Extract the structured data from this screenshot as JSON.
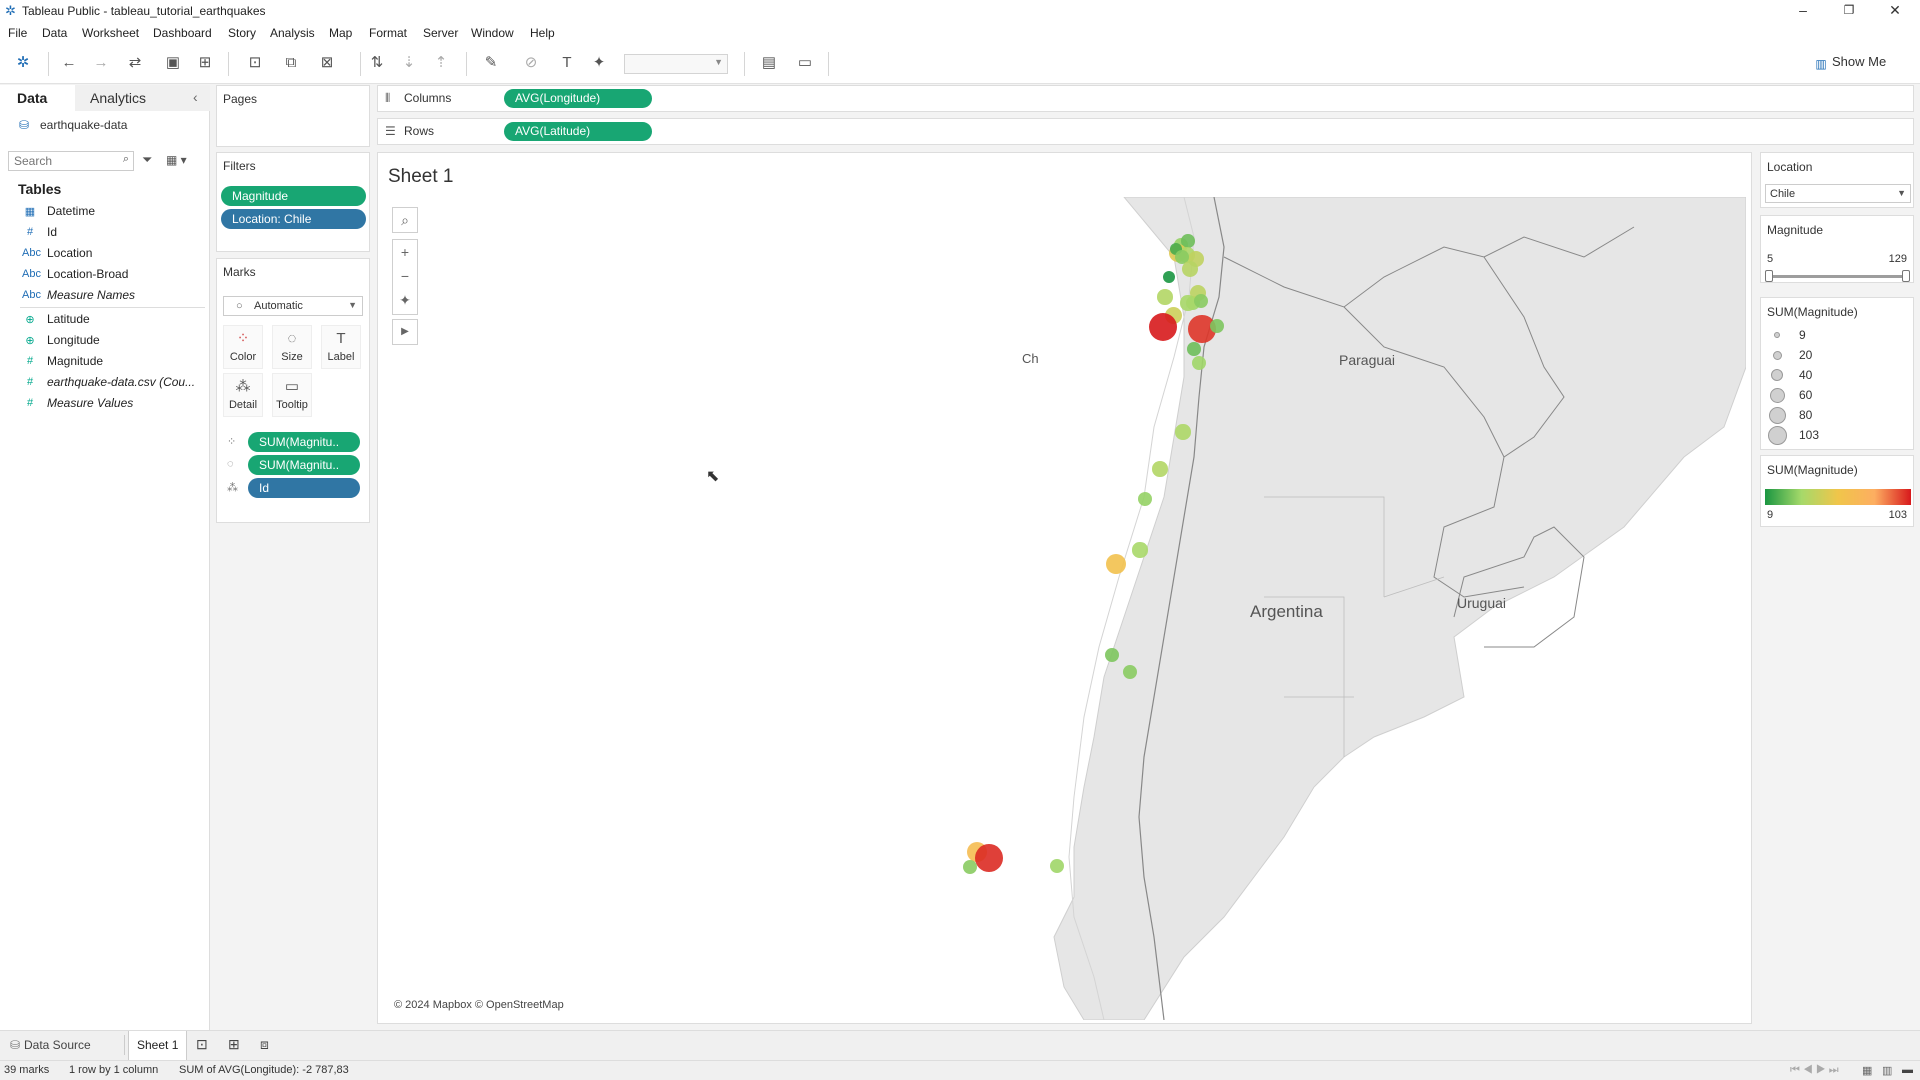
{
  "window": {
    "title": "Tableau Public - tableau_tutorial_earthquakes",
    "controls": [
      "–",
      "❐",
      "✕"
    ]
  },
  "menu": [
    "File",
    "Data",
    "Worksheet",
    "Dashboard",
    "Story",
    "Analysis",
    "Map",
    "Format",
    "Server",
    "Window",
    "Help"
  ],
  "toolbar": {
    "show_me": "Show Me"
  },
  "datapane": {
    "tabs": [
      "Data",
      "Analytics"
    ],
    "datasource": "earthquake-data",
    "search_placeholder": "Search",
    "tables_heading": "Tables",
    "fields": [
      {
        "icon": "calendar-icon",
        "glyph": "▦",
        "name": "Datetime",
        "kind": "dim"
      },
      {
        "icon": "hash-icon",
        "glyph": "#",
        "name": "Id",
        "kind": "dim"
      },
      {
        "icon": "abc-icon",
        "glyph": "Abc",
        "name": "Location",
        "kind": "dim"
      },
      {
        "icon": "abc-icon",
        "glyph": "Abc",
        "name": "Location-Broad",
        "kind": "dim"
      },
      {
        "icon": "abc-icon",
        "glyph": "Abc",
        "name": "Measure Names",
        "kind": "dim",
        "italic": true
      },
      {
        "icon": "globe-icon",
        "glyph": "⊕",
        "name": "Latitude",
        "kind": "mea"
      },
      {
        "icon": "globe-icon",
        "glyph": "⊕",
        "name": "Longitude",
        "kind": "mea"
      },
      {
        "icon": "hash-icon",
        "glyph": "#",
        "name": "Magnitude",
        "kind": "mea"
      },
      {
        "icon": "hash-icon",
        "glyph": "#",
        "name": "earthquake-data.csv (Cou...",
        "kind": "mea",
        "italic": true
      },
      {
        "icon": "hash-icon",
        "glyph": "#",
        "name": "Measure Values",
        "kind": "mea",
        "italic": true
      }
    ]
  },
  "cards": {
    "pages": "Pages",
    "filters": "Filters",
    "filter_pills": [
      "Magnitude",
      "Location: Chile"
    ],
    "marks": "Marks",
    "mark_type": "Automatic",
    "mark_buttons": [
      {
        "name": "color",
        "label": "Color",
        "glyph": "⁘"
      },
      {
        "name": "size",
        "label": "Size",
        "glyph": "◌"
      },
      {
        "name": "label",
        "label": "Label",
        "glyph": "T"
      },
      {
        "name": "detail",
        "label": "Detail",
        "glyph": "⁂"
      },
      {
        "name": "tooltip",
        "label": "Tooltip",
        "glyph": "▭"
      }
    ],
    "mark_pills": [
      {
        "icon": "color-icon",
        "glyph": "⁘",
        "text": "SUM(Magnitu..",
        "color": "green"
      },
      {
        "icon": "size-icon",
        "glyph": "◌",
        "text": "SUM(Magnitu..",
        "color": "green"
      },
      {
        "icon": "detail-icon",
        "glyph": "⁂",
        "text": "Id",
        "color": "blue"
      }
    ]
  },
  "shelves": {
    "columns_label": "Columns",
    "columns_pill": "AVG(Longitude)",
    "rows_label": "Rows",
    "rows_pill": "AVG(Latitude)"
  },
  "sheet": {
    "title": "Sheet 1",
    "attribution": "© 2024 Mapbox © OpenStreetMap",
    "map_labels": [
      "Ch",
      "Paraguai",
      "Argentina",
      "Uruguai"
    ]
  },
  "legends": {
    "location_title": "Location",
    "location_value": "Chile",
    "magnitude_title": "Magnitude",
    "magnitude_min": "5",
    "magnitude_max": "129",
    "magnitude_range": [
      5,
      129
    ],
    "size_title": "SUM(Magnitude)",
    "size_items": [
      "9",
      "20",
      "40",
      "60",
      "80",
      "103"
    ],
    "color_title": "SUM(Magnitude)",
    "color_min": "9",
    "color_max": "103",
    "color_stops": [
      "#1a9641",
      "#a6d96a",
      "#f0c54a",
      "#fdae61",
      "#d7191c"
    ]
  },
  "map_points": [
    {
      "m": 15
    },
    {
      "m": 12
    },
    {
      "m": 30
    },
    {
      "m": 18
    },
    {
      "m": 22
    },
    {
      "m": 10
    },
    {
      "m": 14
    },
    {
      "m": 9
    },
    {
      "m": 20
    },
    {
      "m": 16
    },
    {
      "m": 25
    },
    {
      "m": 19
    },
    {
      "m": 103
    },
    {
      "m": 95
    },
    {
      "m": 21
    },
    {
      "m": 17
    },
    {
      "m": 14
    },
    {
      "m": 13
    },
    {
      "m": 12
    },
    {
      "m": 16
    },
    {
      "m": 18
    },
    {
      "m": 19
    },
    {
      "m": 15
    },
    {
      "m": 40
    },
    {
      "m": 17
    },
    {
      "m": 13
    },
    {
      "m": 14
    },
    {
      "m": 45
    },
    {
      "m": 98
    },
    {
      "m": 14
    },
    {
      "m": 16
    }
  ],
  "bottom_tabs": [
    "Data Source",
    "Sheet 1"
  ],
  "status": [
    "39 marks",
    "1 row by 1 column",
    "SUM of AVG(Longitude): -2 787,83"
  ]
}
